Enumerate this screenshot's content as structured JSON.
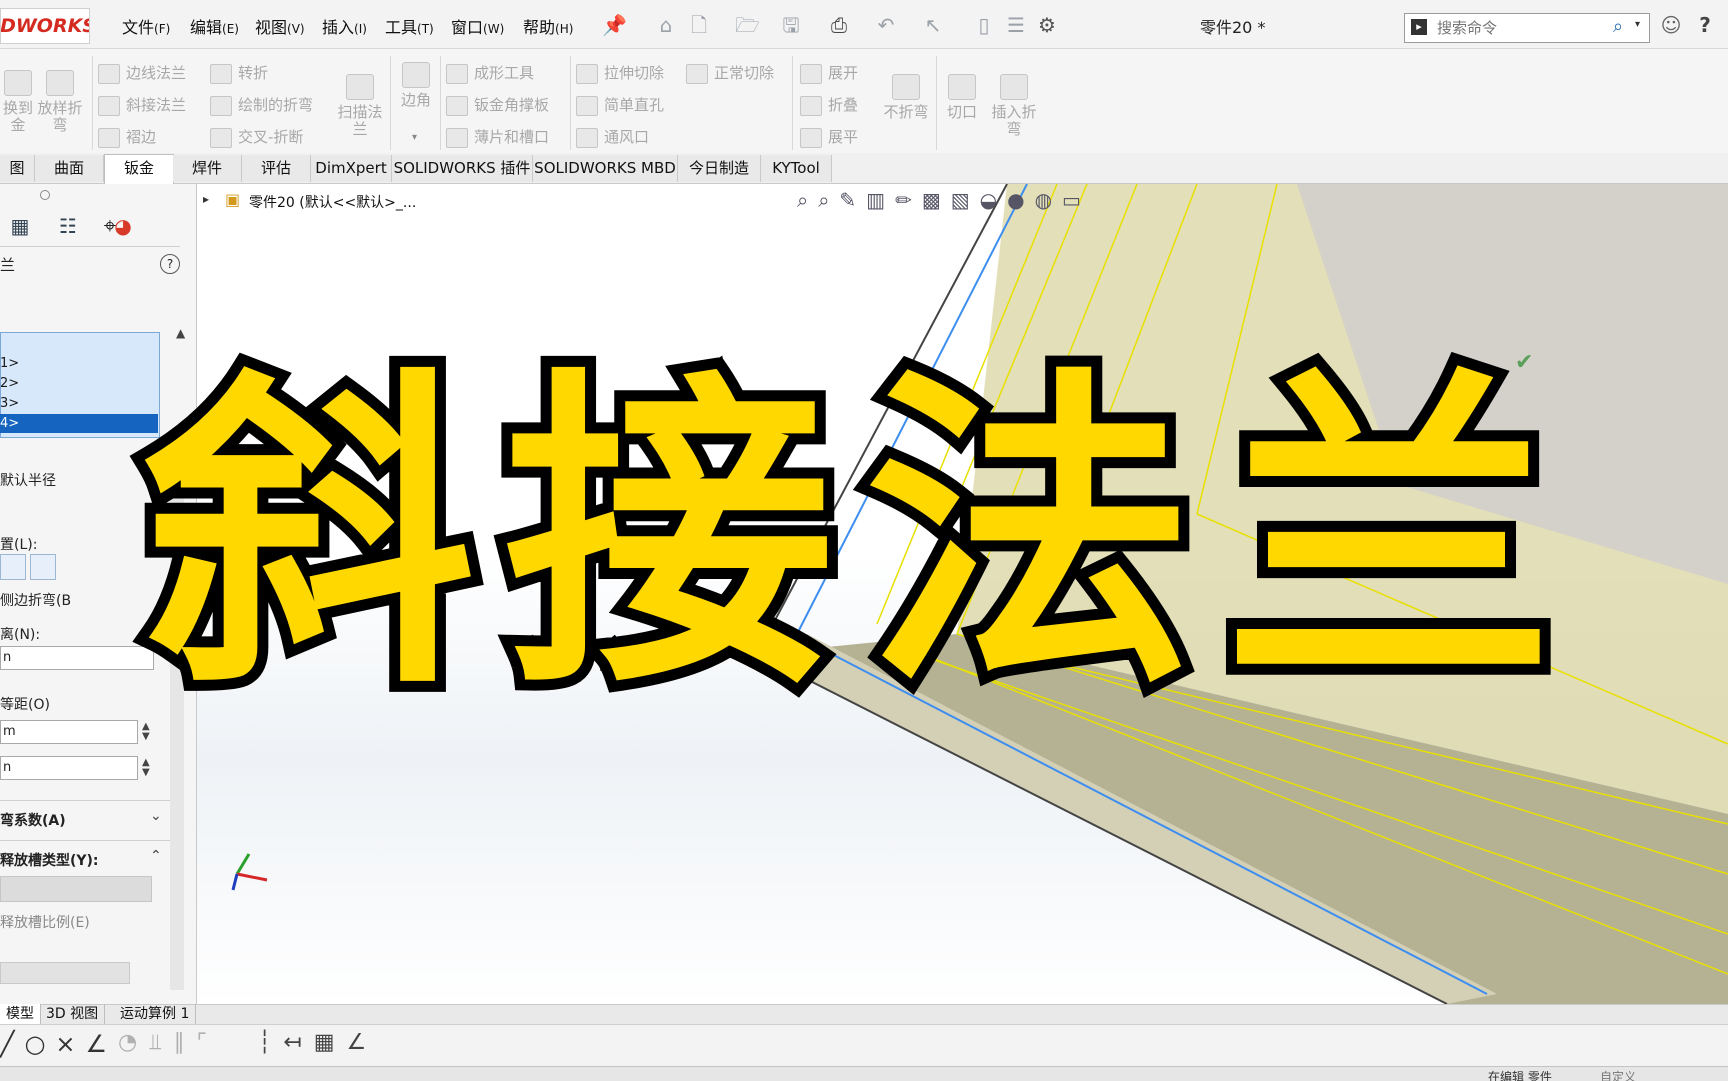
{
  "app": {
    "logo_text": "IDWORKS",
    "doc_title": "零件20 *"
  },
  "menu": [
    {
      "label": "文件",
      "key": "(F)"
    },
    {
      "label": "编辑",
      "key": "(E)"
    },
    {
      "label": "视图",
      "key": "(V)"
    },
    {
      "label": "插入",
      "key": "(I)"
    },
    {
      "label": "工具",
      "key": "(T)"
    },
    {
      "label": "窗口",
      "key": "(W)"
    },
    {
      "label": "帮助",
      "key": "(H)"
    }
  ],
  "search": {
    "placeholder": "搜索命令"
  },
  "ribbon": {
    "left_large": {
      "line1": "换到",
      "line2": "金"
    },
    "lofted_bend": {
      "line1": "放样折",
      "line2": "弯"
    },
    "edge_flange": "边线法兰",
    "miter_flange": "斜接法兰",
    "hem": "褶边",
    "jog": "转折",
    "sketched_bend": "绘制的折弯",
    "cross_break": "交叉-折断",
    "swept_flange": {
      "line1": "扫描法",
      "line2": "兰"
    },
    "corners": "边角",
    "forming_tool": "成形工具",
    "gusset": "钣金角撑板",
    "tab_slot": "薄片和槽口",
    "extruded_cut": "拉伸切除",
    "simple_hole": "简单直孔",
    "vent": "通风口",
    "normal_cut": "正常切除",
    "unfold": "展开",
    "fold": "折叠",
    "flatten": "展平",
    "no_bends": "不折弯",
    "rip": "切口",
    "insert_bends": {
      "line1": "插入折",
      "line2": "弯"
    }
  },
  "tabs": [
    "图",
    "曲面",
    "钣金",
    "焊件",
    "评估",
    "DimXpert",
    "SOLIDWORKS 插件",
    "SOLIDWORKS MBD",
    "今日制造",
    "KYTool"
  ],
  "active_tab": "钣金",
  "feature_tree": {
    "root": "零件20 (默认<<默认>_..."
  },
  "panel": {
    "title": "兰",
    "list_items": [
      "1>",
      "2>",
      "3>",
      "4>"
    ],
    "selected_item": "4>",
    "default_radius": "默认半径",
    "position_label": "置(L):",
    "trim_side_bends": "侧边折弯(B",
    "gap_distance": "离(N):",
    "gap_value": "n",
    "start_end_offset": "等距(O)",
    "offset_start": "m",
    "offset_end": "n",
    "bend_allowance": "弯系数(A)",
    "relief_type": "释放槽类型(Y):",
    "relief_ratio": "释放槽比例(E)"
  },
  "bottom_tabs": [
    "模型",
    "3D 视图",
    "运动算例 1"
  ],
  "status": {
    "left": "在编辑 零件",
    "right": "自定义"
  },
  "overlay_title": "斜接法兰"
}
